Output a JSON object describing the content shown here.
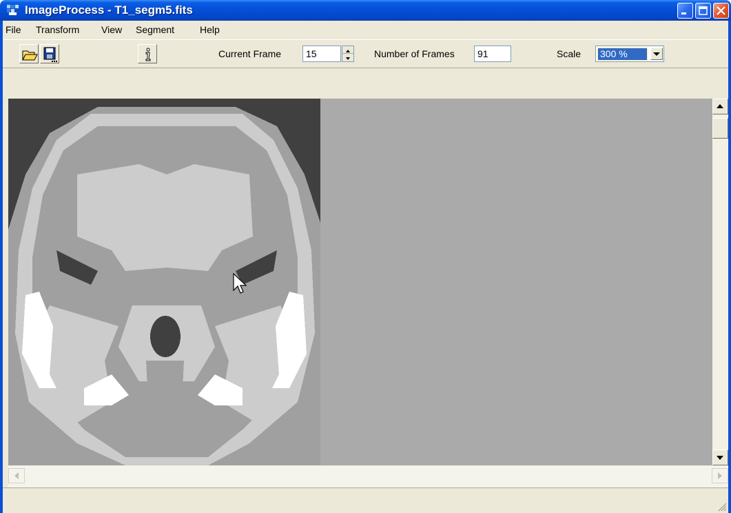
{
  "window": {
    "title": "ImageProcess - T1_segm5.fits",
    "controls": [
      "minimize-icon",
      "maximize-icon",
      "close-icon"
    ]
  },
  "menu": {
    "items": [
      "File",
      "Transform",
      "View",
      "Segment",
      "Help"
    ]
  },
  "toolbar": {
    "buttons": [
      "open-folder-icon",
      "save-icon",
      "info-icon"
    ],
    "current_frame_label": "Current Frame",
    "current_frame_value": "15",
    "num_frames_label": "Number of Frames",
    "num_frames_value": "91",
    "scale_label": "Scale",
    "scale_value": "300 %"
  },
  "colors": {
    "titlebar": "#0550d8",
    "client_bg": "#ece9d8",
    "canvas_bg": "#aaaaaa",
    "scan_dark": "#404040",
    "scan_mid": "#a0a0a0",
    "scan_light": "#cccccc",
    "scan_white": "#ffffff",
    "selection": "#316ac5"
  }
}
